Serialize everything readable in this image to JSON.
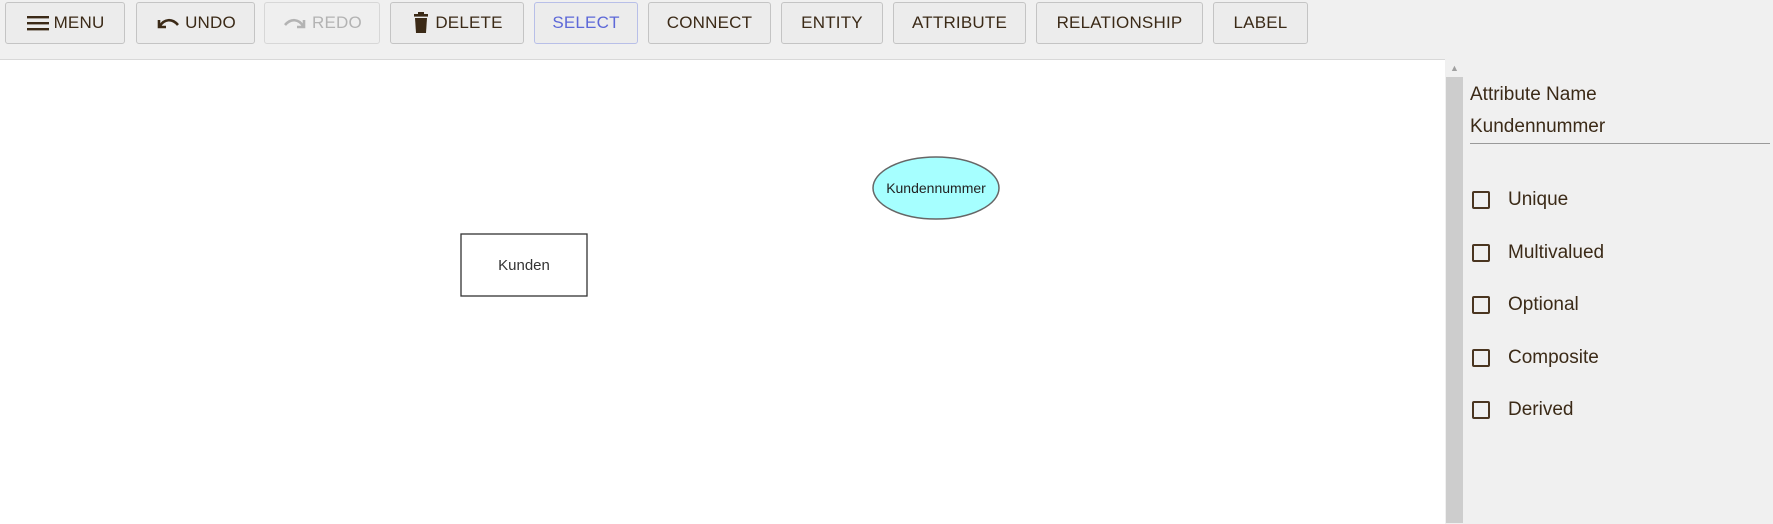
{
  "toolbar": {
    "menu": "MENU",
    "undo": "UNDO",
    "redo": "REDO",
    "delete": "DELETE",
    "select": "SELECT",
    "connect": "CONNECT",
    "entity": "ENTITY",
    "attribute": "ATTRIBUTE",
    "relationship": "RELATIONSHIP",
    "label": "LABEL",
    "active_tool": "select"
  },
  "diagram": {
    "entities": [
      {
        "name": "Kunden"
      }
    ],
    "attributes": [
      {
        "name": "Kundennummer",
        "fill": "#a6ffff"
      }
    ]
  },
  "panel": {
    "field_label": "Attribute Name",
    "field_value": "Kundennummer",
    "options": [
      {
        "label": "Unique",
        "checked": false
      },
      {
        "label": "Multivalued",
        "checked": false
      },
      {
        "label": "Optional",
        "checked": false
      },
      {
        "label": "Composite",
        "checked": false
      },
      {
        "label": "Derived",
        "checked": false
      }
    ]
  },
  "colors": {
    "text": "#3b2a17",
    "active": "#5d68d8",
    "disabled": "#b3b3b3",
    "attribute_fill": "#a6ffff"
  }
}
